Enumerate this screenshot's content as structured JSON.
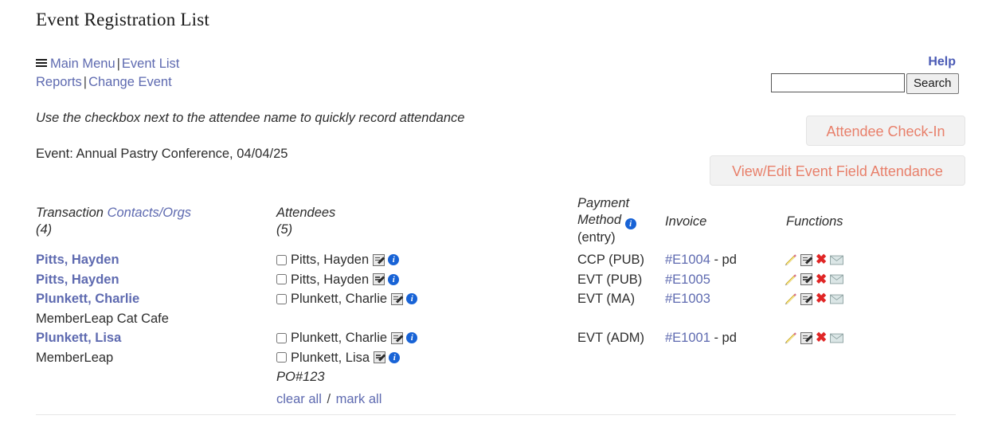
{
  "page": {
    "title": "Event Registration List",
    "instruction": "Use the checkbox next to the attendee name to quickly record attendance",
    "event_line": "Event: Annual Pastry Conference, 04/04/25"
  },
  "nav": {
    "menu_icon": "hamburger-icon",
    "main_menu": "Main Menu",
    "event_list": "Event List",
    "reports": "Reports",
    "change_event": "Change Event",
    "separator": "|"
  },
  "header_right": {
    "help": "Help",
    "search_value": "",
    "search_placeholder": "",
    "search_button": "Search",
    "checkin_button": "Attendee Check-In",
    "field_attendance_button": "View/Edit Event Field Attendance"
  },
  "columns": {
    "transaction_label": "Transaction ",
    "transaction_link": "Contacts/Orgs",
    "transaction_count": "(4)",
    "attendees_label": "Attendees",
    "attendees_count": "(5)",
    "payment_line1": "Payment",
    "payment_line2": "Method",
    "payment_info_icon": "info-icon",
    "payment_line3": "(entry)",
    "invoice_label": "Invoice",
    "functions_label": "Functions"
  },
  "transactions": [
    {
      "name": "Pitts, Hayden",
      "org": ""
    },
    {
      "name": "Pitts, Hayden",
      "org": ""
    },
    {
      "name": "Plunkett, Charlie",
      "org": "MemberLeap Cat Cafe"
    },
    {
      "name": "Plunkett, Lisa",
      "org": "MemberLeap"
    }
  ],
  "attendees": [
    {
      "name": "Pitts, Hayden",
      "checked": false
    },
    {
      "name": "Pitts, Hayden",
      "checked": false
    },
    {
      "name": "Plunkett, Charlie",
      "checked": false
    },
    {
      "name": "Plunkett, Charlie",
      "checked": false
    },
    {
      "name": "Plunkett, Lisa",
      "checked": false
    }
  ],
  "po_note": "PO#123",
  "bulk": {
    "clear_all": "clear all",
    "separator": "/",
    "mark_all": "mark all"
  },
  "rows": [
    {
      "payment_method": "CCP (PUB)",
      "invoice": "#E1004",
      "paid": " - pd"
    },
    {
      "payment_method": "EVT (PUB)",
      "invoice": "#E1005",
      "paid": ""
    },
    {
      "payment_method": "EVT (MA)",
      "invoice": "#E1003",
      "paid": ""
    },
    {
      "payment_method": "EVT (ADM)",
      "invoice": "#E1001",
      "paid": " - pd"
    }
  ],
  "function_icons": {
    "edit": "pencil-icon",
    "note": "edit-note-icon",
    "delete": "delete-x-icon",
    "email": "envelope-icon"
  },
  "colors": {
    "link": "#5e6ab0",
    "help": "#4a5ab5",
    "button_text": "#e8806b",
    "button_bg": "#f2f2f2",
    "info_icon": "#1863d6",
    "delete_icon": "#e02626"
  }
}
